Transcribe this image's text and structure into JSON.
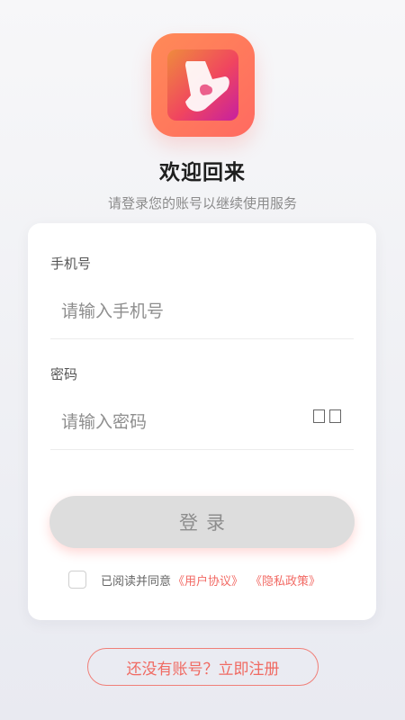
{
  "header": {
    "title": "欢迎回来",
    "subtitle": "请登录您的账号以继续使用服务"
  },
  "form": {
    "phone": {
      "label": "手机号",
      "placeholder": "请输入手机号",
      "value": ""
    },
    "password": {
      "label": "密码",
      "placeholder": "请输入密码",
      "value": ""
    },
    "login_label": "登录",
    "agreement": {
      "checked": false,
      "text": "已阅读并同意",
      "user_agreement": "《用户协议》",
      "privacy_policy": "《隐私政策》"
    }
  },
  "register_label": "还没有账号？立即注册",
  "icons": {
    "app_logo": "play-logo-icon",
    "password_toggle": "eye-toggle-icon"
  },
  "colors": {
    "accent": "#f06a62",
    "icon_gradient_start": "#ff8a57",
    "icon_gradient_end": "#c620a0",
    "button_disabled_bg": "#dddddd",
    "card_bg": "#ffffff"
  }
}
